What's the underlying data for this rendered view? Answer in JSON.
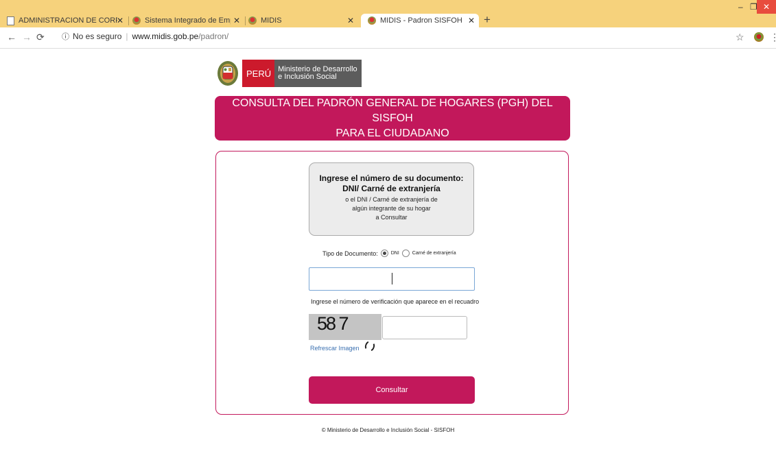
{
  "browser": {
    "tabs": [
      {
        "title": "ADMINISTRACION DE CORREOS",
        "icon": "document-icon"
      },
      {
        "title": "Sistema Integrado de Empadronamiento",
        "icon": "midis-shield-icon"
      },
      {
        "title": "MIDIS",
        "icon": "midis-shield-icon"
      },
      {
        "title": "MIDIS - Padron SISFOH",
        "icon": "midis-shield-icon",
        "active": true
      }
    ],
    "security": "No es seguro",
    "url_host": "www.midis.gob.pe",
    "url_path": "/padron/"
  },
  "logo": {
    "peru": "PERÚ",
    "ministry_line1": "Ministerio de Desarrollo",
    "ministry_line2": "e Inclusión Social"
  },
  "banner": {
    "line1": "CONSULTA DEL PADRÓN GENERAL DE HOGARES (PGH) DEL SISFOH",
    "line2": "PARA EL CIUDADANO"
  },
  "info": {
    "line1": "Ingrese el número de su documento:",
    "line2": "DNI/ Carné de extranjería",
    "line3": "o el DNI / Carné de extranjería de",
    "line4": "algún integrante de su hogar",
    "line5": "a Consultar"
  },
  "form": {
    "doctype_label": "Tipo de Documento:",
    "option_dni": "DNI",
    "option_ce": "Carné de extranjería",
    "selected": "DNI",
    "document_value": "",
    "verification_label": "Ingrese el número de verificación que aparece en el recuadro",
    "captcha_text": "58 7",
    "captcha_value": "",
    "refresh_label": "Refrescar Imagen",
    "submit_label": "Consultar"
  },
  "footer": "© Ministerio de Desarrollo e Inclusión Social - SISFOH",
  "colors": {
    "brand": "#c2185b",
    "peru_red": "#cc1a2c",
    "tabbar": "#f6d27c"
  }
}
